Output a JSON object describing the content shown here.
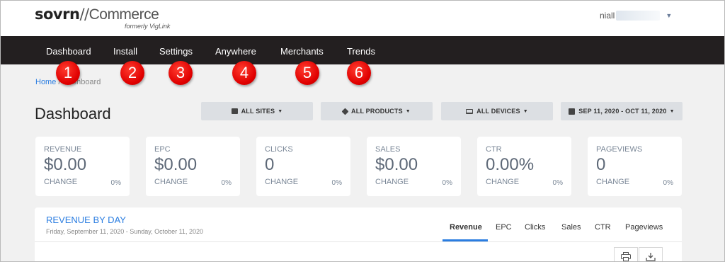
{
  "brand": {
    "name": "sovrn",
    "separator": "//",
    "product": "Commerce",
    "tagline": "formerly VigLink"
  },
  "user": {
    "name": "niall"
  },
  "nav": [
    {
      "label": "Dashboard"
    },
    {
      "label": "Install"
    },
    {
      "label": "Settings"
    },
    {
      "label": "Anywhere"
    },
    {
      "label": "Merchants"
    },
    {
      "label": "Trends"
    }
  ],
  "callouts": [
    "1",
    "2",
    "3",
    "4",
    "5",
    "6"
  ],
  "breadcrumb": {
    "home": "Home",
    "separator": " / ",
    "current": "Dashboard"
  },
  "page_title": "Dashboard",
  "filters": [
    {
      "label": "ALL SITES",
      "icon": "window-icon"
    },
    {
      "label": "ALL PRODUCTS",
      "icon": "cube-icon"
    },
    {
      "label": "ALL DEVICES",
      "icon": "laptop-icon"
    },
    {
      "label": "SEP 11, 2020 - OCT 11, 2020",
      "icon": "calendar-icon"
    }
  ],
  "stats": [
    {
      "label": "REVENUE",
      "value": "$0.00",
      "change_label": "CHANGE",
      "change": "0%"
    },
    {
      "label": "EPC",
      "value": "$0.00",
      "change_label": "CHANGE",
      "change": "0%"
    },
    {
      "label": "CLICKS",
      "value": "0",
      "change_label": "CHANGE",
      "change": "0%"
    },
    {
      "label": "SALES",
      "value": "$0.00",
      "change_label": "CHANGE",
      "change": "0%"
    },
    {
      "label": "CTR",
      "value": "0.00%",
      "change_label": "CHANGE",
      "change": "0%"
    },
    {
      "label": "PAGEVIEWS",
      "value": "0",
      "change_label": "CHANGE",
      "change": "0%"
    }
  ],
  "revenue_panel": {
    "title": "REVENUE BY DAY",
    "subtitle": "Friday, September 11, 2020 - Sunday, October 11, 2020",
    "tabs": [
      "Revenue",
      "EPC",
      "Clicks",
      "Sales",
      "CTR",
      "Pageviews"
    ],
    "active_tab": "Revenue"
  },
  "colors": {
    "nav_bg": "#231f20",
    "accent": "#2a7de1",
    "callout": "#e00000",
    "page_bg": "#f1f1f1"
  }
}
